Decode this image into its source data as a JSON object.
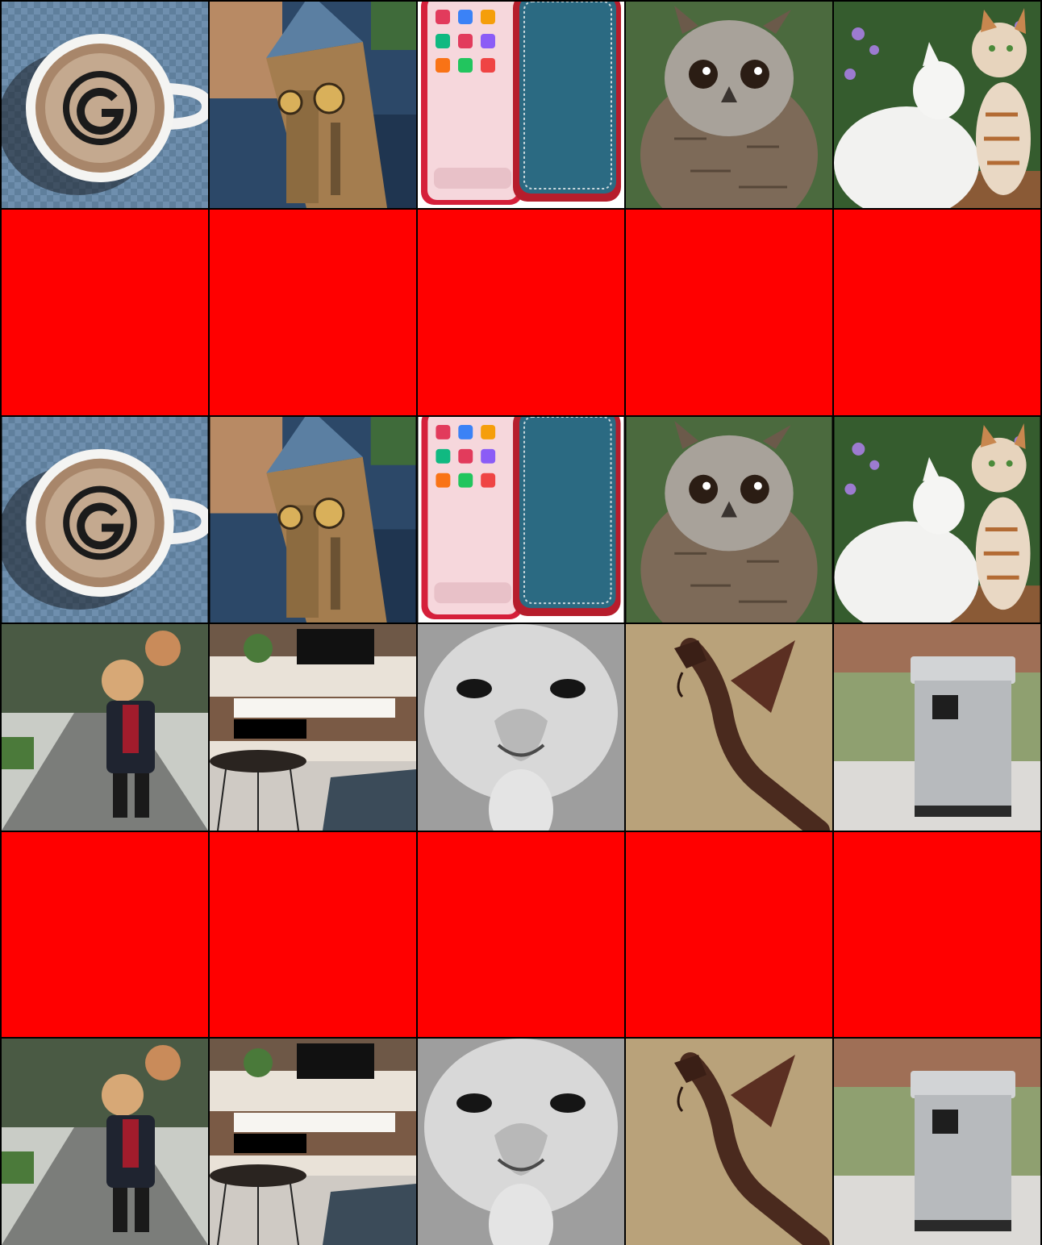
{
  "grid": {
    "rows": 6,
    "cols": 5,
    "palette": {
      "mask": "#ff0000",
      "gutter": "#000000"
    },
    "cells": [
      [
        "coffee-cup-icon",
        "clock-tower-icon",
        "phone-case-icon",
        "owl-icon",
        "cats-icon"
      ],
      [
        "red-mask",
        "red-mask",
        "red-mask",
        "red-mask",
        "red-mask"
      ],
      [
        "coffee-cup-icon",
        "clock-tower-icon",
        "phone-case-icon",
        "owl-icon",
        "cats-icon"
      ],
      [
        "puppet-man-icon",
        "living-room-icon",
        "ostrich-icon",
        "dragon-icon",
        "trash-can-icon"
      ],
      [
        "red-mask",
        "red-mask",
        "red-mask",
        "red-mask",
        "red-mask"
      ],
      [
        "puppet-man-icon",
        "living-room-icon",
        "ostrich-icon",
        "dragon-icon",
        "trash-can-icon"
      ]
    ]
  }
}
